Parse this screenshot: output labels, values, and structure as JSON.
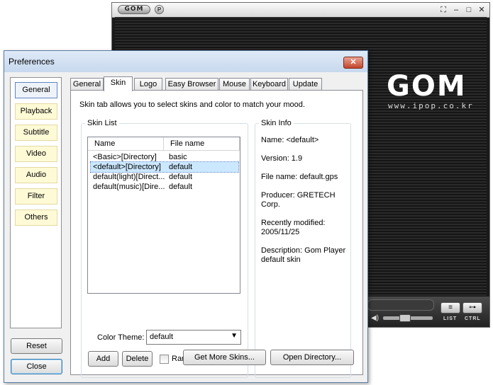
{
  "gom": {
    "logo_pill": "GOM",
    "p_button": "P",
    "window_buttons": [
      "⛶",
      "–",
      "□",
      "✕"
    ],
    "big_logo": "GOM",
    "url": "www.ipop.co.kr",
    "list_label": "LIST",
    "ctrl_label": "CTRL",
    "list_btn_icon": "list-icon",
    "ctrl_btn_icon": "ctrl-icon"
  },
  "dialog": {
    "title": "Preferences",
    "close_glyph": "✕"
  },
  "categories": [
    {
      "label": "General",
      "selected": true
    },
    {
      "label": "Playback"
    },
    {
      "label": "Subtitle"
    },
    {
      "label": "Video"
    },
    {
      "label": "Audio"
    },
    {
      "label": "Filter"
    },
    {
      "label": "Others"
    }
  ],
  "bottom_buttons": {
    "reset": "Reset",
    "close": "Close"
  },
  "tabs": [
    {
      "label": "General"
    },
    {
      "label": "Skin",
      "active": true
    },
    {
      "label": "Logo"
    },
    {
      "label": "Easy Browser"
    },
    {
      "label": "Mouse"
    },
    {
      "label": "Keyboard"
    },
    {
      "label": "Update"
    }
  ],
  "skin_tab": {
    "description": "Skin tab allows you to select skins and color to match your mood.",
    "skin_list": {
      "legend": "Skin List",
      "columns": [
        "Name",
        "File name"
      ],
      "rows": [
        {
          "name": "<Basic>[Directory]",
          "file": "basic"
        },
        {
          "name": "<default>[Directory]",
          "file": "default",
          "selected": true
        },
        {
          "name": "default(light)[Direct...",
          "file": "default"
        },
        {
          "name": "default(music)[Dire...",
          "file": "default"
        }
      ],
      "color_theme_label": "Color Theme:",
      "color_theme_value": "default",
      "add": "Add",
      "delete": "Delete",
      "random_label": "Random Selection"
    },
    "skin_info": {
      "legend": "Skin Info",
      "name": "Name: <default>",
      "version": "Version: 1.9",
      "file_name": "File name: default.gps",
      "producer_1": "Producer: GRETECH",
      "producer_2": "Corp.",
      "modified_1": "Recently modified:",
      "modified_2": "2005/11/25",
      "description_1": "Description: Gom Player",
      "description_2": "default skin"
    },
    "get_more": "Get More Skins...",
    "open_dir": "Open Directory..."
  }
}
